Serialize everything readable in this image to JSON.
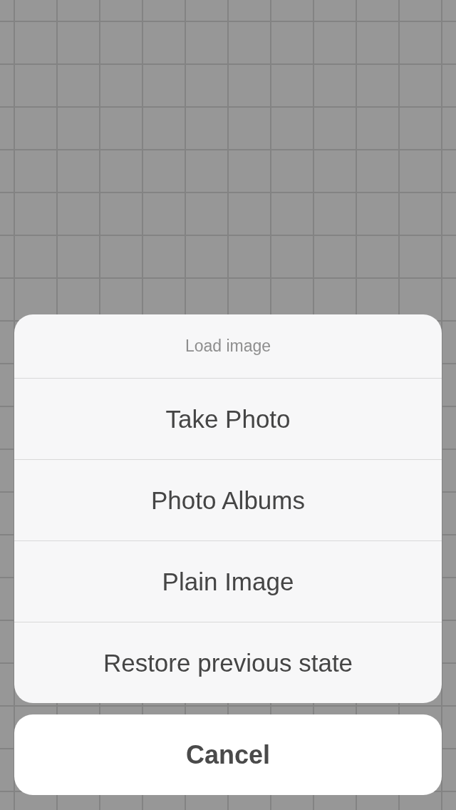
{
  "action_sheet": {
    "title": "Load image",
    "actions": [
      {
        "label": "Take Photo"
      },
      {
        "label": "Photo Albums"
      },
      {
        "label": "Plain Image"
      },
      {
        "label": "Restore previous state"
      }
    ]
  },
  "cancel_button": {
    "label": "Cancel"
  }
}
